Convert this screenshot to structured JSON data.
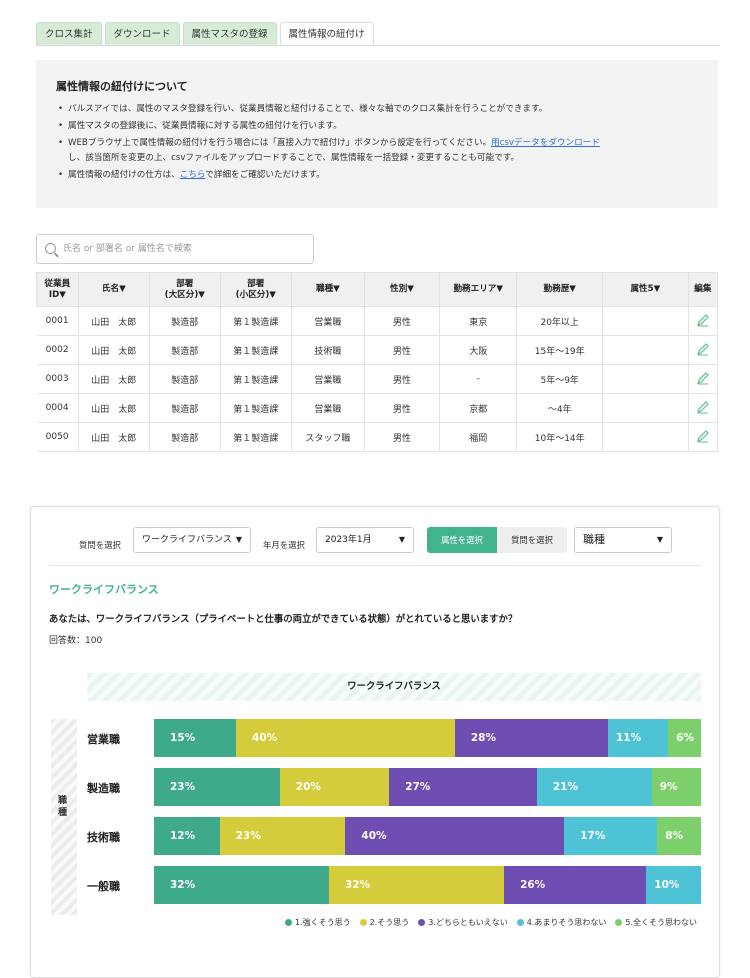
{
  "tabs": [
    "クロス集計",
    "ダウンロード",
    "属性マスタの登録",
    "属性情報の紐付け"
  ],
  "info": {
    "title": "属性情報の紐付けについて",
    "bullet1": "パルスアイでは、属性のマスタ登録を行い、従業員情報と紐付けることで、様々な軸でのクロス集計を行うことができます。",
    "bullet2": "属性マスタの登録後に、従業員情報に対する属性の紐付けを行います。",
    "bullet3_a": "WEBブラウザ上で属性情報の紐付けを行う場合には「直接入力で紐付け」ボタンから設定を行ってください。",
    "bullet3_link": "用csvデータをダウンロード",
    "bullet3_b": "し、該当箇所を変更の上、csvファイルをアップロードすることで、属性情報を一括登録・変更することも可能です。",
    "bullet4_a": "属性情報の紐付けの仕方は、",
    "bullet4_link": "こちら",
    "bullet4_b": "で詳細をご確認いただけます。"
  },
  "search": {
    "placeholder": "氏名 or 部署名 or 属性名で検索",
    "icon": "search-icon"
  },
  "table": {
    "headers": [
      "従業員\nID▼",
      "氏名▼",
      "部署\n(大区分)▼",
      "部署\n(小区分)▼",
      "職種▼",
      "性別▼",
      "勤務エリア▼",
      "勤務歴▼",
      "属性5▼",
      "編集"
    ],
    "rows": [
      [
        "0001",
        "山田　太郎",
        "製造部",
        "第１製造課",
        "営業職",
        "男性",
        "東京",
        "20年以上",
        ""
      ],
      [
        "0002",
        "山田　太郎",
        "製造部",
        "第１製造課",
        "技術職",
        "男性",
        "大阪",
        "15年〜19年",
        ""
      ],
      [
        "0003",
        "山田　太郎",
        "製造部",
        "第１製造課",
        "営業職",
        "男性",
        "-",
        "5年〜9年",
        ""
      ],
      [
        "0004",
        "山田　太郎",
        "製造部",
        "第１製造課",
        "営業職",
        "男性",
        "京都",
        "〜4年",
        ""
      ],
      [
        "0050",
        "山田　太郎",
        "製造部",
        "第１製造課",
        "スタッフ職",
        "男性",
        "福岡",
        "10年〜14年",
        ""
      ]
    ]
  },
  "panel": {
    "question_select_label": "質問を選択",
    "question_select_value": "ワークライフバランス",
    "month_select_label": "年月を選択",
    "month_select_value": "2023年1月",
    "seg_on": "属性を選択",
    "seg_off": "質問を選択",
    "attr_select_value": "職種",
    "section_title": "ワークライフバランス",
    "question": "あなたは、ワークライフバランス（プライベートと仕事の両立ができている状態）がとれていると思いますか？",
    "answer_count": "回答数：100",
    "chart_header": "ワークライフバランス",
    "axis_group": "職種"
  },
  "chart_data": {
    "type": "bar",
    "orientation": "horizontal-stacked-100",
    "title": "ワークライフバランス",
    "categories": [
      "営業職",
      "製造職",
      "技術職",
      "一般職"
    ],
    "series": [
      {
        "name": "1.強くそう思う",
        "color": "#3fa98b",
        "values": [
          15,
          23,
          12,
          32
        ]
      },
      {
        "name": "2.そう思う",
        "color": "#d4cc3a",
        "values": [
          40,
          20,
          23,
          32
        ]
      },
      {
        "name": "3.どちらともいえない",
        "color": "#6e4eb3",
        "values": [
          28,
          27,
          40,
          26
        ]
      },
      {
        "name": "4.あまりそう思わない",
        "color": "#4ec3d6",
        "values": [
          11,
          21,
          17,
          10
        ]
      },
      {
        "name": "5.全くそう思わない",
        "color": "#7ccf6a",
        "values": [
          6,
          9,
          8,
          0
        ]
      }
    ],
    "legend_position": "bottom-right"
  }
}
